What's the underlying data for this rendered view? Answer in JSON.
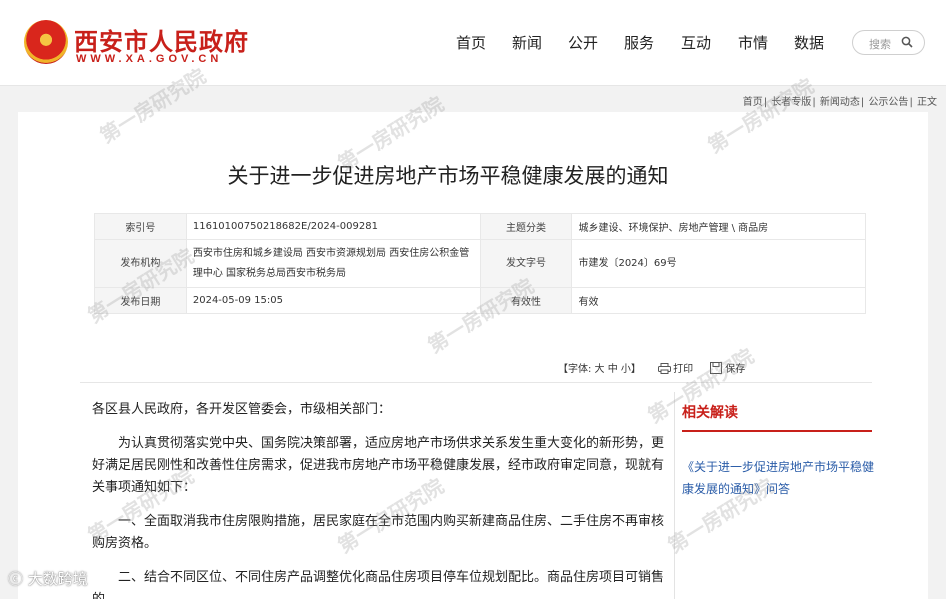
{
  "header": {
    "site_title": "西安市人民政府",
    "site_url": "WWW.XA.GOV.CN",
    "nav": [
      "首页",
      "新闻",
      "公开",
      "服务",
      "互动",
      "市情",
      "数据"
    ],
    "search_placeholder": "搜索"
  },
  "breadcrumb": [
    "首页",
    "长者专版",
    "新闻动态",
    "公示公告",
    "正文"
  ],
  "article": {
    "title": "关于进一步促进房地产市场平稳健康发展的通知",
    "meta": {
      "index_label": "索引号",
      "index_value": "11610100750218682E/2024-009281",
      "topic_label": "主题分类",
      "topic_value": "城乡建设、环境保护、房地产管理 \\ 商品房",
      "issuer_label": "发布机构",
      "issuer_value": "西安市住房和城乡建设局 西安市资源规划局 西安住房公积金管理中心 国家税务总局西安市税务局",
      "doc_no_label": "发文字号",
      "doc_no_value": "市建发〔2024〕69号",
      "date_label": "发布日期",
      "date_value": "2024-05-09 15:05",
      "validity_label": "有效性",
      "validity_value": "有效"
    },
    "tools": {
      "font_label": "【字体: 大 中 小】",
      "print_label": "打印",
      "save_label": "保存"
    },
    "paragraphs": [
      "各区县人民政府，各开发区管委会，市级相关部门：",
      "为认真贯彻落实党中央、国务院决策部署，适应房地产市场供求关系发生重大变化的新形势，更好满足居民刚性和改善性住房需求，促进我市房地产市场平稳健康发展，经市政府审定同意，现就有关事项通知如下：",
      "一、全面取消我市住房限购措施，居民家庭在全市范围内购买新建商品住房、二手住房不再审核购房资格。",
      "二、结合不同区位、不同住房产品调整优化商品住房项目停车位规划配比。商品住房项目可销售的"
    ]
  },
  "related": {
    "title": "相关解读",
    "link": "《关于进一步促进房地产市场平稳健康发展的通知》问答"
  },
  "watermark_text": "第一房研究院",
  "corner_logo": "大数跨境",
  "colors": {
    "brand_red": "#c8201a",
    "link_blue": "#2a5ca8",
    "page_bg": "#f2f2f2"
  }
}
